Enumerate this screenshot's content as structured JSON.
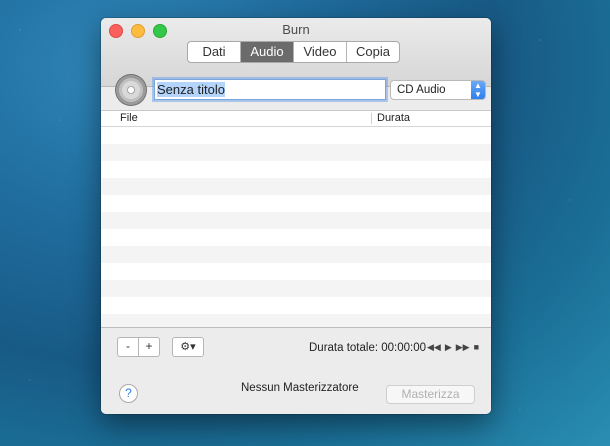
{
  "window": {
    "title": "Burn"
  },
  "tabs": [
    "Dati",
    "Audio",
    "Video",
    "Copia"
  ],
  "active_tab": "Audio",
  "disc": {
    "name_value": "Senza titolo",
    "format_selected": "CD Audio"
  },
  "table": {
    "columns": [
      "File",
      "Durata"
    ],
    "rows": []
  },
  "bottom": {
    "remove_label": "-",
    "add_label": "+",
    "gear_label": "⚙▾",
    "duration_text": "Durata totale: 00:00:00",
    "status_text": "Nessun Masterizzatore",
    "burn_label": "Masterizza",
    "help_label": "?"
  },
  "colors": {
    "accent": "#2d7ff0",
    "tab_active": "#6b6b6b"
  }
}
